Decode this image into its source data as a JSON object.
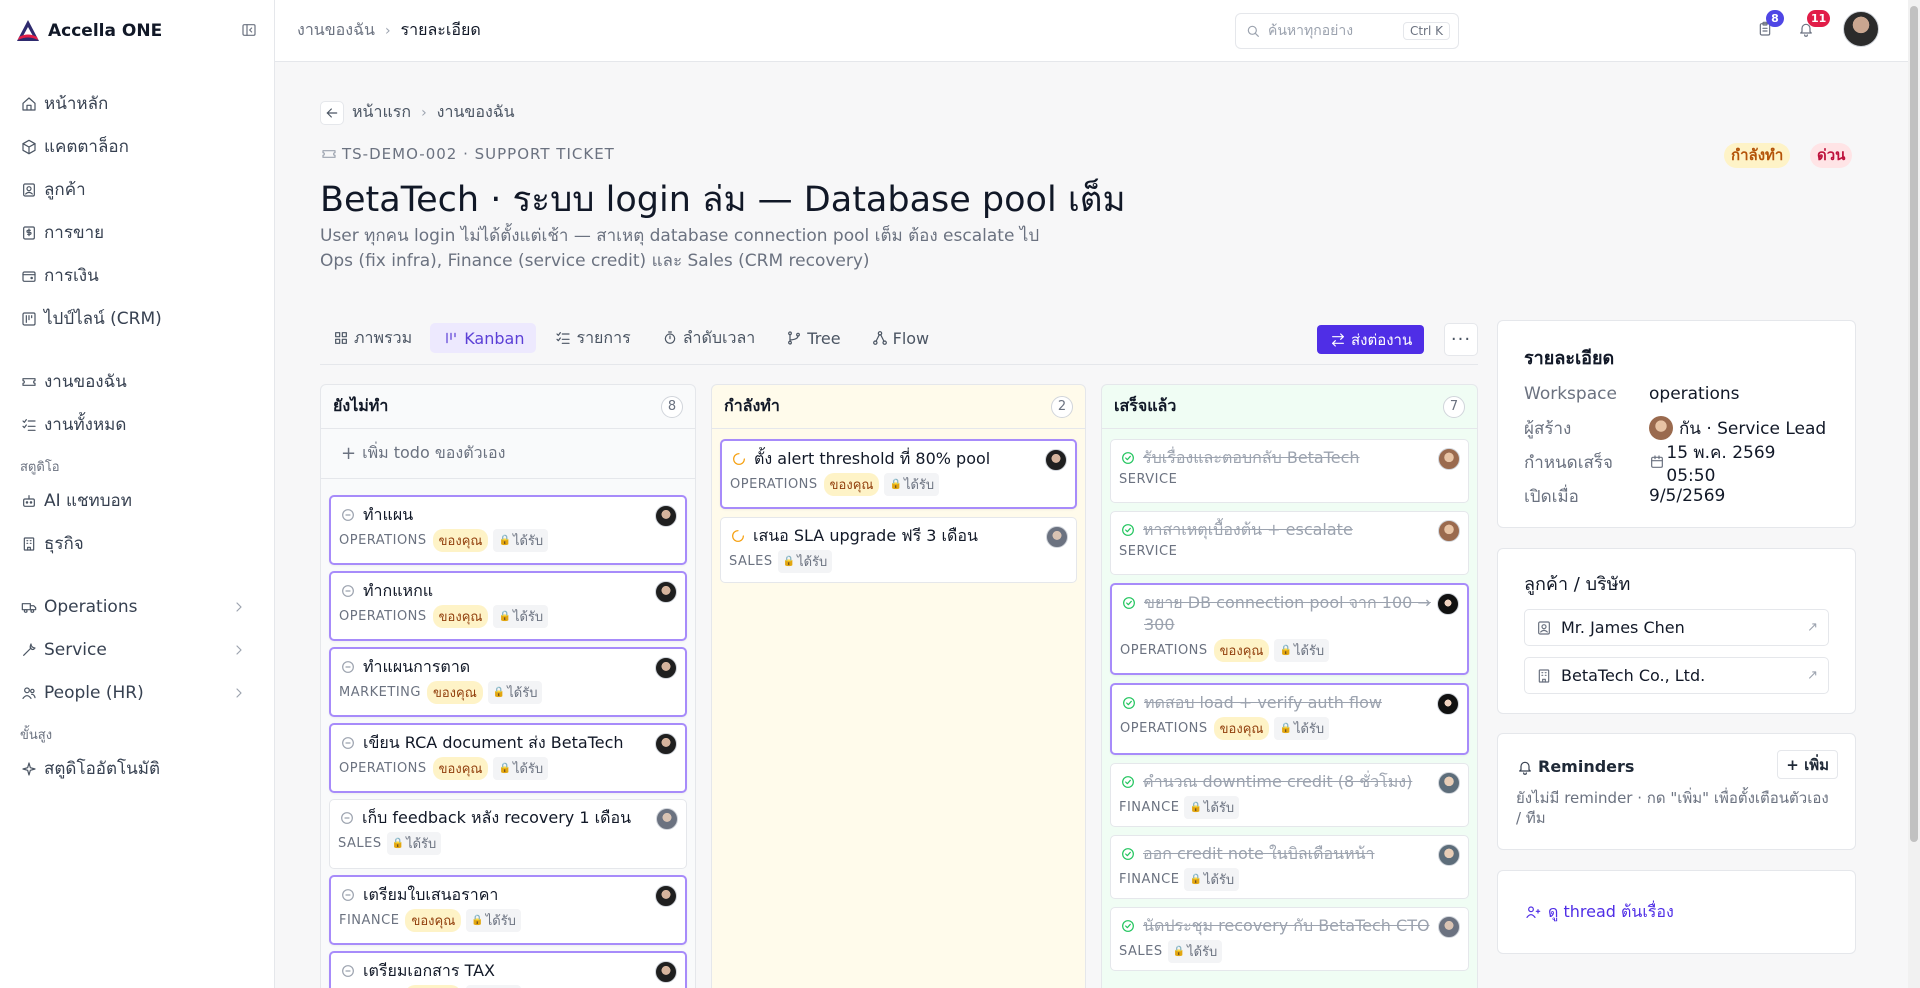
{
  "brand": {
    "name": "Accella ONE"
  },
  "sidebar": {
    "main": [
      {
        "label": "หน้าหลัก",
        "icon": "home-icon"
      },
      {
        "label": "แคตตาล็อก",
        "icon": "package-icon"
      },
      {
        "label": "ลูกค้า",
        "icon": "contact-icon"
      },
      {
        "label": "การขาย",
        "icon": "receipt-icon"
      },
      {
        "label": "การเงิน",
        "icon": "wallet-icon"
      },
      {
        "label": "ไปป์ไลน์ (CRM)",
        "icon": "pipeline-icon"
      }
    ],
    "work": [
      {
        "label": "งานของฉัน",
        "icon": "ticket-icon"
      },
      {
        "label": "งานทั้งหมด",
        "icon": "list-check-icon"
      }
    ],
    "studio_label": "สตูดิโอ",
    "studio": [
      {
        "label": "AI แชทบอท",
        "icon": "bot-icon"
      },
      {
        "label": "ธุรกิจ",
        "icon": "building-icon"
      }
    ],
    "modules": [
      {
        "label": "Operations",
        "icon": "truck-icon"
      },
      {
        "label": "Service",
        "icon": "wrench-icon"
      },
      {
        "label": "People (HR)",
        "icon": "people-icon"
      }
    ],
    "advanced_label": "ขั้นสูง",
    "advanced": [
      {
        "label": "สตูดิโออัตโนมัติ",
        "icon": "sparkle-icon"
      }
    ]
  },
  "topbar": {
    "breadcrumb": [
      "งานของฉัน",
      "รายละเอียด"
    ],
    "search_placeholder": "ค้นหาทุกอย่าง",
    "search_shortcut": "Ctrl K",
    "tasks_count": "8",
    "notifications_count": "11",
    "colors": {
      "tasks_badge": "#4f46e5",
      "notif_badge": "#e11d48"
    }
  },
  "page": {
    "back_crumbs": [
      "หน้าแรก",
      "งานของฉัน"
    ],
    "ticket_id": "TS-DEMO-002 · SUPPORT TICKET",
    "title": "BetaTech · ระบบ login ล่ม — Database pool เต็ม",
    "description": "User ทุกคน login ไม่ได้ตั้งแต่เช้า — สาเหตุ database connection pool เต็ม ต้อง escalate ไป Ops (fix infra), Finance (service credit) และ Sales (CRM recovery)",
    "status": "กำลังทำ",
    "priority": "ด่วน"
  },
  "tabs": [
    {
      "label": "ภาพรวม",
      "icon": "grid-icon"
    },
    {
      "label": "Kanban",
      "icon": "kanban-icon",
      "active": true
    },
    {
      "label": "รายการ",
      "icon": "list-icon"
    },
    {
      "label": "ลำดับเวลา",
      "icon": "timer-icon"
    },
    {
      "label": "Tree",
      "icon": "branch-icon"
    },
    {
      "label": "Flow",
      "icon": "flow-icon"
    }
  ],
  "actions": {
    "send": "ส่งต่องาน",
    "more": "···"
  },
  "board": {
    "received_label": "ได้รับ",
    "yours_label": "ของคุณ",
    "columns": [
      {
        "name": "ยังไม่ทำ",
        "count": "8",
        "add_label": "เพิ่ม todo ของตัวเอง",
        "cards": [
          {
            "title": "ทำแผน",
            "dept": "OPERATIONS",
            "mine": true,
            "avatar": "dark"
          },
          {
            "title": "ทำกแหกแ",
            "dept": "OPERATIONS",
            "mine": true,
            "avatar": "dark"
          },
          {
            "title": "ทำแผนการตาด",
            "dept": "MARKETING",
            "mine": true,
            "avatar": "dark"
          },
          {
            "title": "เขียน RCA document ส่ง BetaTech",
            "dept": "OPERATIONS",
            "mine": true,
            "avatar": "dark"
          },
          {
            "title": "เก็บ feedback หลัง recovery 1 เดือน",
            "dept": "SALES",
            "mine": false,
            "avatar": "grey"
          },
          {
            "title": "เตรียมใบเสนอราคา",
            "dept": "FINANCE",
            "mine": true,
            "avatar": "dark"
          },
          {
            "title": "เตรียมเอกสาร TAX",
            "dept": "FINANCE",
            "mine": true,
            "avatar": "dark"
          }
        ]
      },
      {
        "name": "กำลังทำ",
        "count": "2",
        "cards": [
          {
            "title": "ตั้ง alert threshold ที่ 80% pool",
            "dept": "OPERATIONS",
            "mine": true,
            "avatar": "dark"
          },
          {
            "title": "เสนอ SLA upgrade ฟรี 3 เดือน",
            "dept": "SALES",
            "mine": false,
            "avatar": "grey"
          }
        ]
      },
      {
        "name": "เสร็จแล้ว",
        "count": "7",
        "cards": [
          {
            "title": "รับเรื่องและตอบกลับ BetaTech",
            "dept": "SERVICE",
            "mine": false,
            "avatar": "warm",
            "norecv": true
          },
          {
            "title": "หาสาเหตุเบื้องต้น + escalate",
            "dept": "SERVICE",
            "mine": false,
            "avatar": "warm",
            "norecv": true
          },
          {
            "title": "ขยาย DB connection pool จาก 100 → 300",
            "dept": "OPERATIONS",
            "mine": true,
            "avatar": "lady"
          },
          {
            "title": "ทดสอบ load + verify auth flow",
            "dept": "OPERATIONS",
            "mine": true,
            "avatar": "lady"
          },
          {
            "title": "คำนวณ downtime credit (8 ชั่วโมง)",
            "dept": "FINANCE",
            "mine": false,
            "avatar": "glass"
          },
          {
            "title": "ออก credit note ในบิลเดือนหน้า",
            "dept": "FINANCE",
            "mine": false,
            "avatar": "glass"
          },
          {
            "title": "นัดประชุม recovery กับ BetaTech CTO",
            "dept": "SALES",
            "mine": false,
            "avatar": "grey"
          }
        ]
      }
    ]
  },
  "details": {
    "title": "รายละเอียด",
    "workspace_label": "Workspace",
    "workspace": "operations",
    "creator_label": "ผู้สร้าง",
    "creator": "กัน · Service Lead",
    "due_label": "กำหนดเสร็จ",
    "due": "15 พ.ค. 2569 05:50",
    "opened_label": "เปิดเมื่อ",
    "opened": "9/5/2569"
  },
  "customer": {
    "title": "ลูกค้า / บริษัท",
    "contact": "Mr. James Chen",
    "company": "BetaTech Co., Ltd."
  },
  "reminders": {
    "title": "Reminders",
    "add": "+ เพิ่ม",
    "empty": "ยังไม่มี reminder · กด \"เพิ่ม\" เพื่อตั้งเตือนตัวเอง / ทีม"
  },
  "thread": {
    "label": "ดู thread ต้นเรื่อง"
  },
  "colors": {
    "accent": "#4f2ee6",
    "status_bg": "#fef3c7",
    "status_fg": "#b45309",
    "priority_bg": "#ffe4e6",
    "priority_fg": "#be123c",
    "todo_bg": "#f9fafb",
    "doing_bg": "#fffbeb",
    "done_bg": "#f0fdf4"
  }
}
